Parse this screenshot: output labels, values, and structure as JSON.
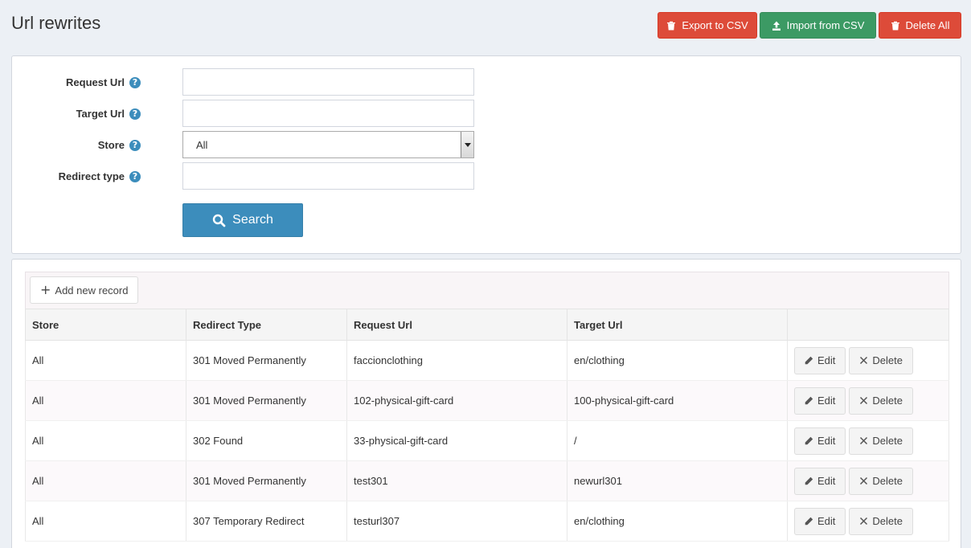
{
  "header": {
    "title": "Url rewrites",
    "buttons": {
      "export_label": "Export to CSV",
      "import_label": "Import from CSV",
      "delete_all_label": "Delete All"
    }
  },
  "search_form": {
    "fields": {
      "request_url": {
        "label": "Request Url",
        "value": ""
      },
      "target_url": {
        "label": "Target Url",
        "value": ""
      },
      "store": {
        "label": "Store",
        "selected": "All"
      },
      "redirect_type": {
        "label": "Redirect type",
        "value": ""
      }
    },
    "help_glyph": "?",
    "search_label": "Search"
  },
  "grid": {
    "add_label": "Add new record",
    "columns": [
      "Store",
      "Redirect Type",
      "Request Url",
      "Target Url",
      ""
    ],
    "rows": [
      {
        "store": "All",
        "redirect_type": "301 Moved Permanently",
        "request_url": "faccionclothing",
        "target_url": "en/clothing"
      },
      {
        "store": "All",
        "redirect_type": "301 Moved Permanently",
        "request_url": "102-physical-gift-card",
        "target_url": "100-physical-gift-card"
      },
      {
        "store": "All",
        "redirect_type": "302 Found",
        "request_url": "33-physical-gift-card",
        "target_url": "/"
      },
      {
        "store": "All",
        "redirect_type": "301 Moved Permanently",
        "request_url": "test301",
        "target_url": "newurl301"
      },
      {
        "store": "All",
        "redirect_type": "307 Temporary Redirect",
        "request_url": "testurl307",
        "target_url": "en/clothing"
      }
    ],
    "edit_label": "Edit",
    "delete_label": "Delete"
  },
  "colors": {
    "danger": "#dd4b39",
    "success": "#3c9a64",
    "primary": "#3c8dbc"
  },
  "icons": [
    "trash-icon",
    "upload-icon",
    "question-circle-icon",
    "search-icon",
    "plus-icon",
    "pencil-icon",
    "close-icon",
    "chevron-down-icon"
  ]
}
